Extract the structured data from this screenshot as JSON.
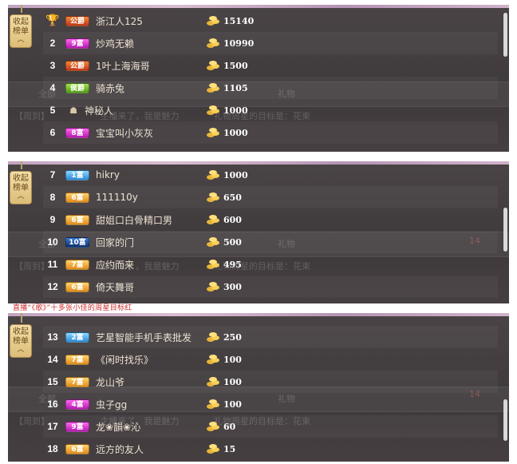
{
  "collapse_label_top": "收起",
  "collapse_label_bottom": "榜单",
  "background_text": {
    "quanbu": "全部",
    "liwu": "礼物",
    "rank_num": "14",
    "chat_line_1": "【周到】",
    "chat_line_2": "主播来了，我是魅力",
    "chat_line_3": "礼物周星的目标是：花束"
  },
  "panels": [
    {
      "rows": [
        {
          "rank": "",
          "badge": "公爵",
          "badge_color": "red",
          "name": "浙江人125",
          "amount": "15140",
          "icon": "trophy-icon"
        },
        {
          "rank": "2",
          "badge": "9富",
          "badge_color": "purple",
          "name": "炒鸡无赖",
          "amount": "10990"
        },
        {
          "rank": "3",
          "badge": "公爵",
          "badge_color": "red",
          "name": "1叶上海海哥",
          "amount": "1500"
        },
        {
          "rank": "4",
          "badge": "侯爵",
          "badge_color": "green",
          "name": "骑赤兔",
          "amount": "1105"
        },
        {
          "rank": "5",
          "badge": "",
          "badge_color": "",
          "name": "神秘人",
          "amount": "1000",
          "icon": "mystery-icon"
        },
        {
          "rank": "6",
          "badge": "8富",
          "badge_color": "purple",
          "name": "宝宝叫小灰灰",
          "amount": "1000"
        }
      ]
    },
    {
      "rows": [
        {
          "rank": "7",
          "badge": "1富",
          "badge_color": "blue",
          "name": "hikry",
          "amount": "1000"
        },
        {
          "rank": "8",
          "badge": "6富",
          "badge_color": "yellow",
          "name": "111110y",
          "amount": "650"
        },
        {
          "rank": "9",
          "badge": "6富",
          "badge_color": "yellow",
          "name": "甜姐口白骨精口男",
          "amount": "600"
        },
        {
          "rank": "10",
          "badge": "10富",
          "badge_color": "dark",
          "name": "回家的门",
          "amount": "500"
        },
        {
          "rank": "11",
          "badge": "7富",
          "badge_color": "yellow",
          "name": "应约而来",
          "amount": "495"
        },
        {
          "rank": "12",
          "badge": "6富",
          "badge_color": "yellow",
          "name": "倚天舞哥",
          "amount": "300"
        }
      ]
    },
    {
      "rows": [
        {
          "rank": "13",
          "badge": "2富",
          "badge_color": "blue",
          "name": "艺星智能手机手表批发",
          "amount": "250"
        },
        {
          "rank": "14",
          "badge": "7富",
          "badge_color": "yellow",
          "name": "《闲时找乐》",
          "amount": "100"
        },
        {
          "rank": "15",
          "badge": "7富",
          "badge_color": "yellow",
          "name": "龙山爷",
          "amount": "100"
        },
        {
          "rank": "16",
          "badge": "4富",
          "badge_color": "purple",
          "name": "虫子gg",
          "amount": "100"
        },
        {
          "rank": "17",
          "badge": "9富",
          "badge_color": "purple",
          "name": "龙❀韻❀沁",
          "amount": "60"
        },
        {
          "rank": "18",
          "badge": "6富",
          "badge_color": "yellow",
          "name": "远方的友人",
          "amount": "15"
        }
      ]
    }
  ],
  "stray_text": "直播“《歌》”十多张小佳的周星目标红"
}
